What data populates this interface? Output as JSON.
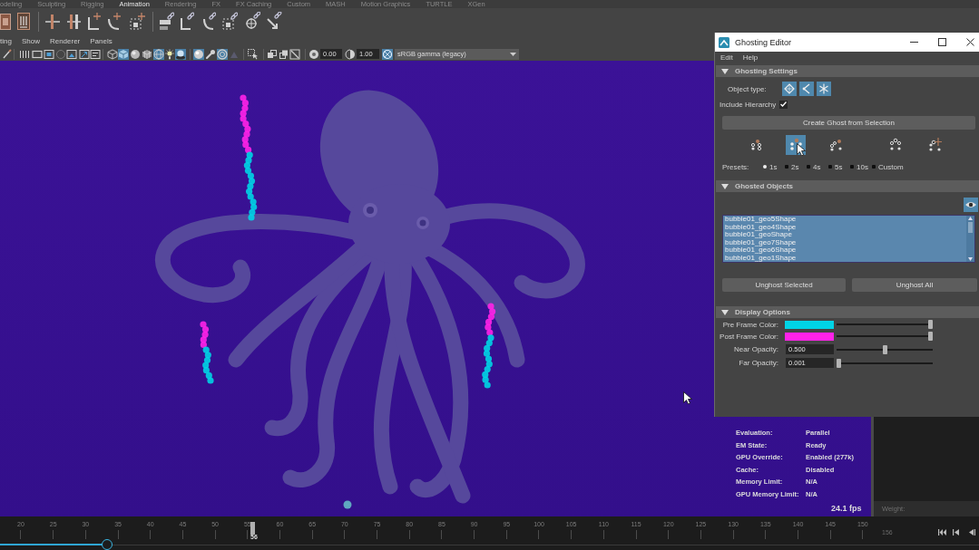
{
  "shelf_tabs": [
    {
      "label": "odeling",
      "selected": false
    },
    {
      "label": "Sculpting",
      "selected": false
    },
    {
      "label": "Rigging",
      "selected": false
    },
    {
      "label": "Animation",
      "selected": true
    },
    {
      "label": "Rendering",
      "selected": false
    },
    {
      "label": "FX",
      "selected": false
    },
    {
      "label": "FX Caching",
      "selected": false
    },
    {
      "label": "Custom",
      "selected": false
    },
    {
      "label": "MASH",
      "selected": false
    },
    {
      "label": "Motion Graphics",
      "selected": false
    },
    {
      "label": "TURTLE",
      "selected": false
    },
    {
      "label": "XGen",
      "selected": false
    }
  ],
  "panel_menu": [
    "ting",
    "Show",
    "Renderer",
    "Panels"
  ],
  "panel_toolbar": {
    "buttons": [
      {
        "on": false
      },
      {
        "on": false
      },
      {
        "on": false
      },
      {
        "on": false
      },
      {
        "on": false
      },
      {
        "on": false
      },
      {
        "on": false
      },
      {
        "on": false
      },
      {
        "on": false
      },
      {
        "on": true
      },
      {
        "on": false
      },
      {
        "on": false
      },
      {
        "on": true
      },
      {
        "on": false
      },
      {
        "on": true
      },
      {
        "on": true
      },
      {
        "on": false
      },
      {
        "on": true
      },
      {
        "on": false
      },
      {
        "on": false
      },
      {
        "on": false
      },
      {
        "on": false
      },
      {
        "on": false
      },
      {
        "on": false
      },
      {
        "on": false
      },
      {
        "on": true
      }
    ],
    "exposure": "0.00",
    "gamma": "1.00",
    "color_space": "sRGB gamma (legacy)"
  },
  "viewport": {
    "hud": [
      {
        "label": "Evaluation:",
        "value": "Parallel"
      },
      {
        "label": "EM State:",
        "value": "Ready"
      },
      {
        "label": "GPU Override:",
        "value": "Enabled (277k)"
      },
      {
        "label": "Cache:",
        "value": "Disabled"
      },
      {
        "label": "Memory Limit:",
        "value": "N/A"
      },
      {
        "label": "GPU Memory Limit:",
        "value": "N/A"
      }
    ],
    "fps": "24.1 fps"
  },
  "side_panel": {
    "label": "Weight:"
  },
  "time_slider": {
    "ticks": [
      "20",
      "25",
      "30",
      "35",
      "40",
      "45",
      "50",
      "55",
      "60",
      "65",
      "70",
      "75",
      "80",
      "85",
      "90",
      "95",
      "100",
      "105",
      "110",
      "115",
      "120",
      "125",
      "130",
      "135",
      "140",
      "145",
      "150"
    ],
    "end_frame": "156",
    "playhead": {
      "frame": "56",
      "level": 0.255
    },
    "range": {
      "level": 0.108
    }
  },
  "ghosting_editor": {
    "title": "Ghosting Editor",
    "menu": [
      "Edit",
      "Help"
    ],
    "ghosting_settings": {
      "title": "Ghosting Settings",
      "expanded": true,
      "object_type_label": "Object type:",
      "object_types": [
        {
          "on": true
        },
        {
          "on": true
        },
        {
          "on": true
        }
      ],
      "include_hierarchy": {
        "label": "Include Hierarchy",
        "checked": true
      },
      "create_button": "Create Ghost from Selection",
      "preset_icons": [
        {
          "selected": false
        },
        {
          "selected": true
        },
        {
          "selected": false
        },
        {
          "selected": false
        },
        {
          "selected": false
        }
      ],
      "presets_label": "Presets:",
      "presets": [
        {
          "label": "1s",
          "selected": true
        },
        {
          "label": "2s",
          "selected": false
        },
        {
          "label": "4s",
          "selected": false
        },
        {
          "label": "5s",
          "selected": false
        },
        {
          "label": "10s",
          "selected": false
        },
        {
          "label": "Custom",
          "selected": false
        }
      ]
    },
    "ghosted_objects": {
      "title": "Ghosted Objects",
      "expanded": true,
      "visibility_toggle": {
        "on": true
      },
      "objects": [
        {
          "name": "bubble01_geo5Shape",
          "selected": true
        },
        {
          "name": "bubble01_geo4Shape",
          "selected": true
        },
        {
          "name": "bubble01_geoShape",
          "selected": true
        },
        {
          "name": "bubble01_geo7Shape",
          "selected": true
        },
        {
          "name": "bubble01_geo6Shape",
          "selected": true
        },
        {
          "name": "bubble01_geo1Shape",
          "selected": true
        }
      ],
      "buttons": [
        "Unghost Selected",
        "Unghost All"
      ]
    },
    "display_options": {
      "title": "Display Options",
      "expanded": true,
      "pre_frame_color": {
        "label": "Pre Frame Color:",
        "color": "#00d4e6",
        "level": 1
      },
      "post_frame_color": {
        "label": "Post Frame Color:",
        "color": "#ff22e8",
        "level": 1
      },
      "near_opacity": {
        "label": "Near Opacity:",
        "value": "0.500",
        "level": 0.5
      },
      "far_opacity": {
        "label": "Far Opacity:",
        "value": "0.001",
        "level": 0.001
      }
    }
  }
}
